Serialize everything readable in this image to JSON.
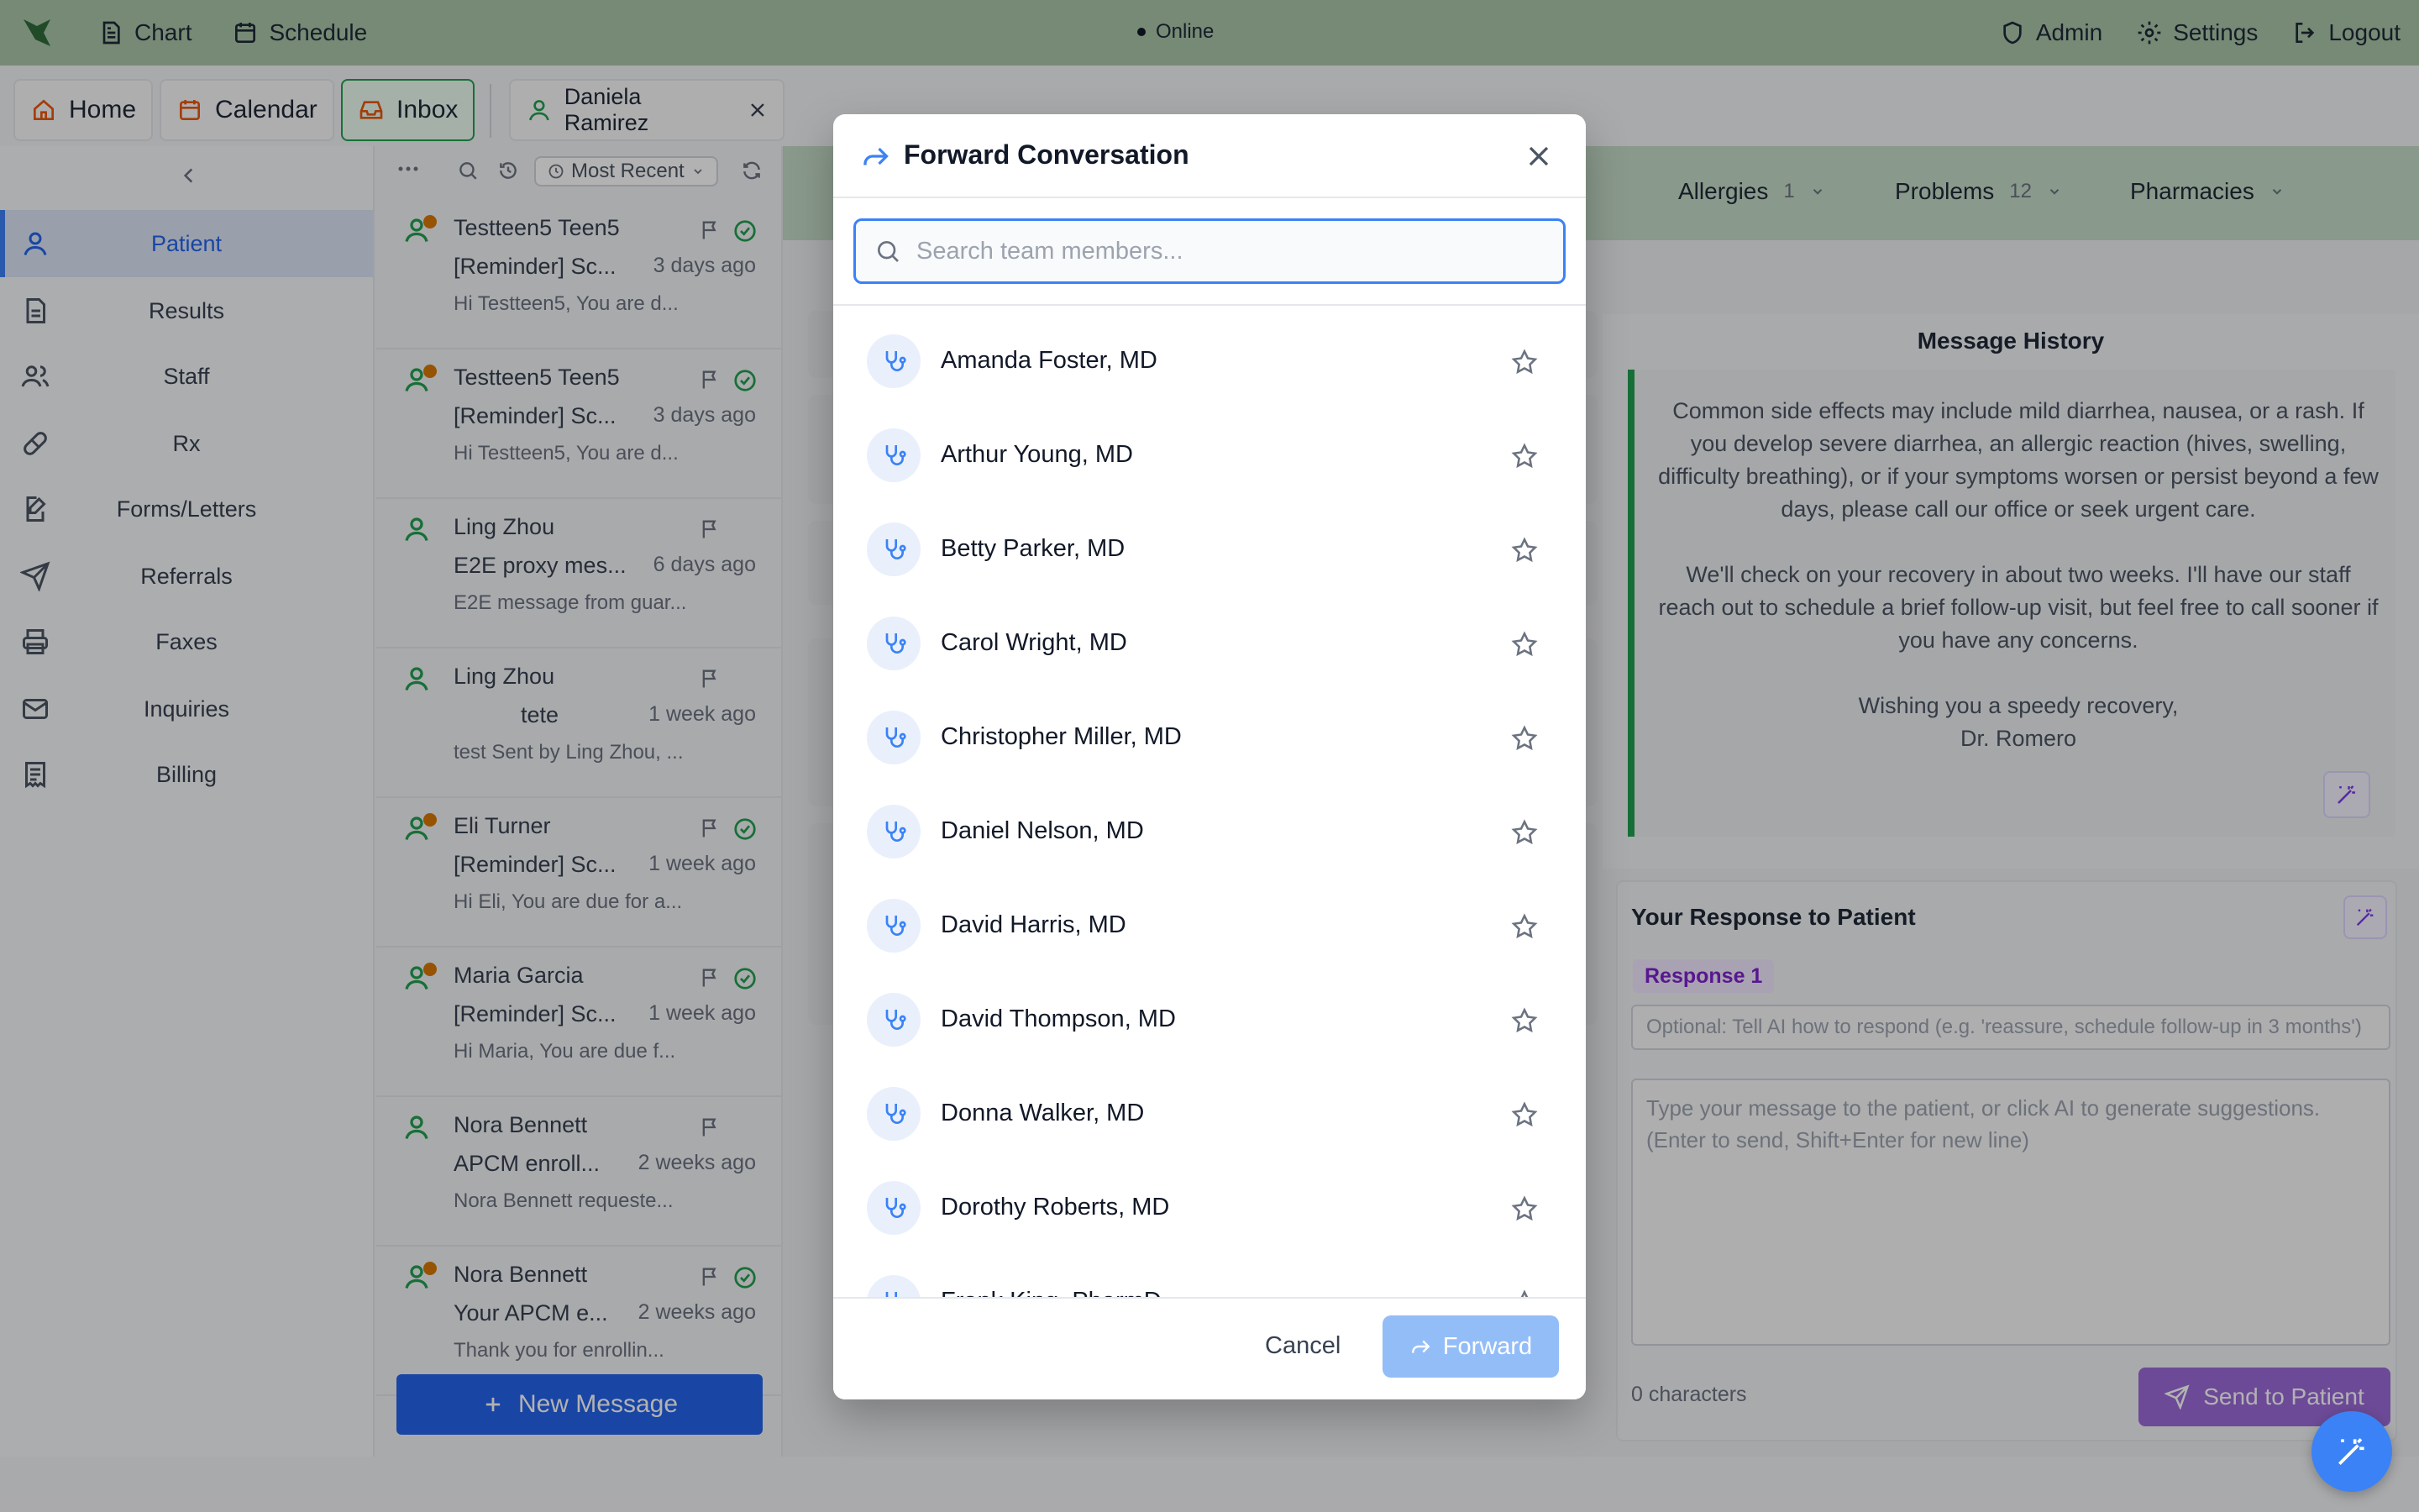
{
  "topbar": {
    "nav": [
      {
        "label": "Chart",
        "icon": "document-icon"
      },
      {
        "label": "Schedule",
        "icon": "calendar-icon"
      }
    ],
    "status": "Online",
    "right": [
      {
        "label": "Admin",
        "icon": "shield-icon"
      },
      {
        "label": "Settings",
        "icon": "gear-icon"
      },
      {
        "label": "Logout",
        "icon": "logout-icon"
      }
    ]
  },
  "tabs": {
    "home": "Home",
    "calendar": "Calendar",
    "inbox": "Inbox",
    "patient": "Daniela Ramirez"
  },
  "sidebar": {
    "items": [
      "Patient",
      "Results",
      "Staff",
      "Rx",
      "Forms/Letters",
      "Referrals",
      "Faxes",
      "Inquiries",
      "Billing"
    ]
  },
  "inbox": {
    "sort_label": "Most Recent",
    "new_message": "New Message",
    "messages": [
      {
        "name": "Testteen5 Teen5",
        "subject": "[Reminder] Sc...",
        "time": "3 days ago",
        "preview": "Hi Testteen5, You are d..."
      },
      {
        "name": "Testteen5 Teen5",
        "subject": "[Reminder] Sc...",
        "time": "3 days ago",
        "preview": "Hi Testteen5, You are d..."
      },
      {
        "name": "Ling Zhou",
        "subject": "E2E proxy mes...",
        "time": "6 days ago",
        "preview": "E2E message from guar..."
      },
      {
        "name": "Ling Zhou",
        "subject": "tete",
        "time": "1 week ago",
        "preview": "test Sent by Ling Zhou, ..."
      },
      {
        "name": "Eli Turner",
        "subject": "[Reminder] Sc...",
        "time": "1 week ago",
        "preview": "Hi Eli, You are due for a..."
      },
      {
        "name": "Maria Garcia",
        "subject": "[Reminder] Sc...",
        "time": "1 week ago",
        "preview": "Hi Maria, You are due f..."
      },
      {
        "name": "Nora Bennett",
        "subject": "APCM enroll...",
        "time": "2 weeks ago",
        "preview": "Nora Bennett requeste..."
      },
      {
        "name": "Nora Bennett",
        "subject": "Your APCM e...",
        "time": "2 weeks ago",
        "preview": "Thank you for enrollin..."
      }
    ]
  },
  "patient_strip": {
    "allergies_label": "Allergies",
    "allergies_count": "1",
    "problems_label": "Problems",
    "problems_count": "12",
    "pharmacies_label": "Pharmacies"
  },
  "history": {
    "title": "Message History",
    "para1": "Common side effects may include mild diarrhea, nausea, or a rash. If you develop severe diarrhea, an allergic reaction (hives, swelling, difficulty breathing), or if your symptoms worsen or persist beyond a few days, please call our office or seek urgent care.",
    "para2": "We'll check on your recovery in about two weeks. I'll have our staff reach out to schedule a brief follow-up visit, but feel free to call sooner if you have any concerns.",
    "closing": "Wishing you a speedy recovery,",
    "signature": "Dr. Romero"
  },
  "response": {
    "title": "Your Response to Patient",
    "tag": "Response 1",
    "ai_hint_placeholder": "Optional: Tell AI how to respond (e.g. 'reassure, schedule follow-up in 3 months')",
    "message_placeholder": "Type your message to the patient, or click AI to generate suggestions. (Enter to send, Shift+Enter for new line)",
    "char_count": "0 characters",
    "send_label": "Send to Patient"
  },
  "modal": {
    "title": "Forward Conversation",
    "search_placeholder": "Search team members...",
    "members": [
      "Amanda Foster, MD",
      "Arthur Young, MD",
      "Betty Parker, MD",
      "Carol Wright, MD",
      "Christopher Miller, MD",
      "Daniel Nelson, MD",
      "David Harris, MD",
      "David Thompson, MD",
      "Donna Walker, MD",
      "Dorothy Roberts, MD",
      "Frank King, PharmD"
    ],
    "cancel_label": "Cancel",
    "forward_label": "Forward"
  },
  "colors": {
    "topbar": "#a9c6aa",
    "accent": "#3b82f6",
    "ai_purple": "#9b6ad8",
    "active_green": "#22a050"
  }
}
